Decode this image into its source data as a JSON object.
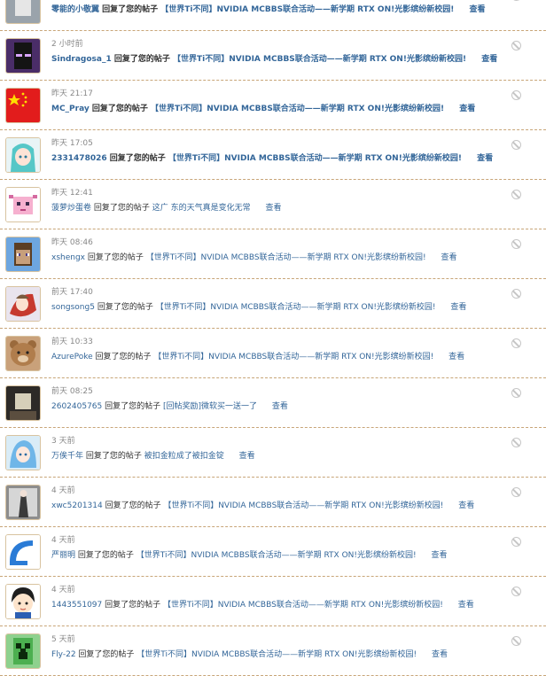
{
  "verb": "回复了您的帖子",
  "view_label": "查看",
  "items": [
    {
      "time": "",
      "user": "零能的小敬翼",
      "subject": "【世界Ti不同】NVIDIA MCBBS联合活动——新学期 RTX ON!光影缤纷新校园!",
      "bold": true,
      "avatar": "dark-avatar"
    },
    {
      "time": "2 小时前",
      "user": "Sindragosa_1",
      "subject": "【世界Ti不同】NVIDIA MCBBS联合活动——新学期 RTX ON!光影缤纷新校园!",
      "bold": true,
      "avatar": "enderman-avatar"
    },
    {
      "time": "昨天 21:17",
      "user": "MC_Pray",
      "subject": "【世界Ti不同】NVIDIA MCBBS联合活动——新学期 RTX ON!光影缤纷新校园!",
      "bold": true,
      "avatar": "flag-avatar"
    },
    {
      "time": "昨天 17:05",
      "user": "2331478026",
      "subject": "【世界Ti不同】NVIDIA MCBBS联合活动——新学期 RTX ON!光影缤纷新校园!",
      "bold": true,
      "avatar": "anime-girl-avatar"
    },
    {
      "time": "昨天 12:41",
      "user": "菠萝炒蛋卷",
      "subject": "这广 东的天气真是变化无常",
      "bold": false,
      "avatar": "pixel-axolotl-avatar"
    },
    {
      "time": "昨天 08:46",
      "user": "xshengx",
      "subject": "【世界Ti不同】NVIDIA MCBBS联合活动——新学期 RTX ON!光影缤纷新校园!",
      "bold": false,
      "avatar": "steve-avatar"
    },
    {
      "time": "前天 17:40",
      "user": "songsong5",
      "subject": "【世界Ti不同】NVIDIA MCBBS联合活动——新学期 RTX ON!光影缤纷新校园!",
      "bold": false,
      "avatar": "anime-warrior-avatar"
    },
    {
      "time": "前天 10:33",
      "user": "AzurePoke",
      "subject": "【世界Ti不同】NVIDIA MCBBS联合活动——新学期 RTX ON!光影缤纷新校园!",
      "bold": false,
      "avatar": "bear-avatar"
    },
    {
      "time": "前天 08:25",
      "user": "2602405765",
      "subject": "[回帖奖励]微软买一送一了",
      "bold": false,
      "avatar": "dark-room-avatar"
    },
    {
      "time": "3 天前",
      "user": "万俟千年",
      "subject": "被扣金粒成了被扣金锭",
      "bold": false,
      "avatar": "blue-hair-avatar"
    },
    {
      "time": "4 天前",
      "user": "xwc5201314",
      "subject": "【世界Ti不同】NVIDIA MCBBS联合活动——新学期 RTX ON!光影缤纷新校园!",
      "bold": false,
      "avatar": "character-avatar"
    },
    {
      "time": "4 天前",
      "user": "严丽明",
      "subject": "【世界Ti不同】NVIDIA MCBBS联合活动——新学期 RTX ON!光影缤纷新校园!",
      "bold": false,
      "avatar": "blue-arc-avatar"
    },
    {
      "time": "4 天前",
      "user": "1443551097",
      "subject": "【世界Ti不同】NVIDIA MCBBS联合活动——新学期 RTX ON!光影缤纷新校园!",
      "bold": false,
      "avatar": "cartoon-boy-avatar"
    },
    {
      "time": "5 天前",
      "user": "Fly-22",
      "subject": "【世界Ti不同】NVIDIA MCBBS联合活动——新学期 RTX ON!光影缤纷新校园!",
      "bold": false,
      "avatar": "creeper-avatar"
    }
  ]
}
